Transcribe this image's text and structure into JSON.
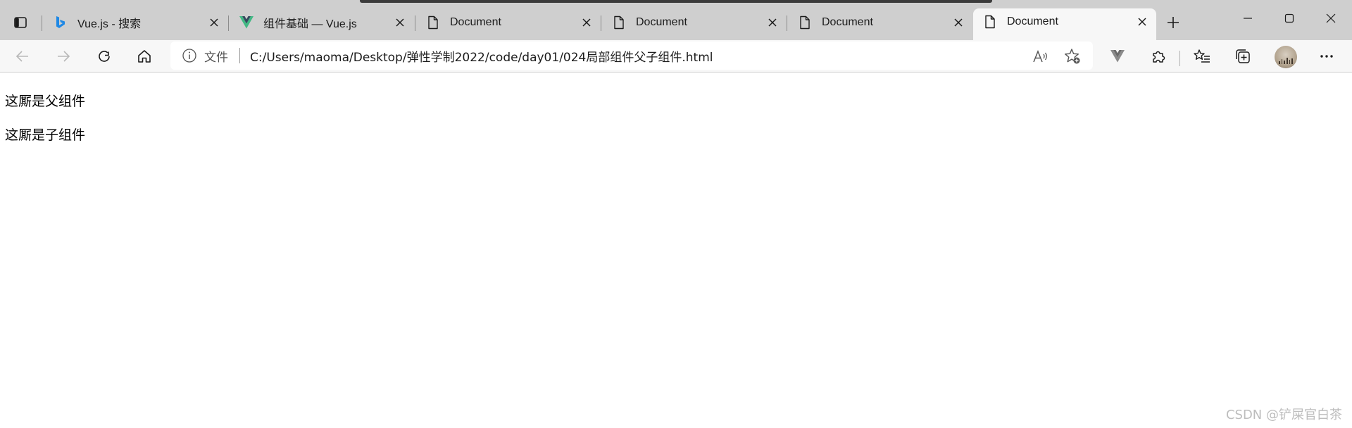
{
  "tabs": [
    {
      "title": "Vue.js - 搜索",
      "favicon": "bing-icon",
      "active": false
    },
    {
      "title": "组件基础 — Vue.js",
      "favicon": "vue-icon",
      "active": false
    },
    {
      "title": "Document",
      "favicon": "document-icon",
      "active": false
    },
    {
      "title": "Document",
      "favicon": "document-icon",
      "active": false
    },
    {
      "title": "Document",
      "favicon": "document-icon",
      "active": false
    },
    {
      "title": "Document",
      "favicon": "document-icon",
      "active": true
    }
  ],
  "address_bar": {
    "site_label": "文件",
    "url": "C:/Users/maoma/Desktop/弹性学制2022/code/day01/024局部组件父子组件.html"
  },
  "page": {
    "lines": [
      "这厮是父组件",
      "这厮是子组件"
    ]
  },
  "watermark": "CSDN @铲屎官白茶",
  "colors": {
    "tabstrip_bg": "#cfcfcf",
    "toolbar_bg": "#f7f7f7",
    "vue_green": "#41b883",
    "bing_blue": "#1e88e5"
  }
}
